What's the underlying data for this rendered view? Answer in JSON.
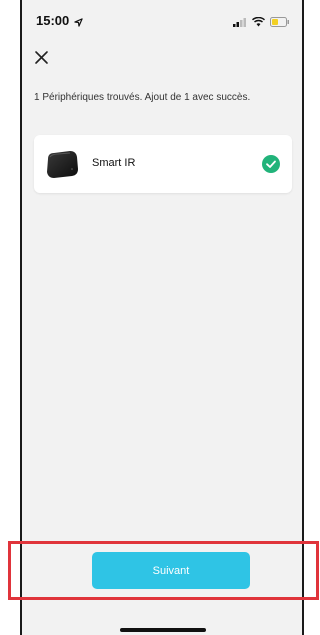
{
  "status_bar": {
    "time": "15:00",
    "icons": [
      "location-arrow-icon",
      "signal-icon",
      "wifi-icon",
      "battery-icon"
    ]
  },
  "header": {
    "close_icon": "close-icon"
  },
  "main": {
    "found_text": "1 Périphériques trouvés. Ajout de 1 avec succès.",
    "device": {
      "name": "Smart IR",
      "image_icon": "smart-ir-device-icon",
      "status_icon": "check-circle-icon"
    }
  },
  "footer": {
    "next_label": "Suivant"
  },
  "colors": {
    "accent": "#2fc4e5",
    "success": "#21b37a",
    "highlight": "#e0343b"
  }
}
